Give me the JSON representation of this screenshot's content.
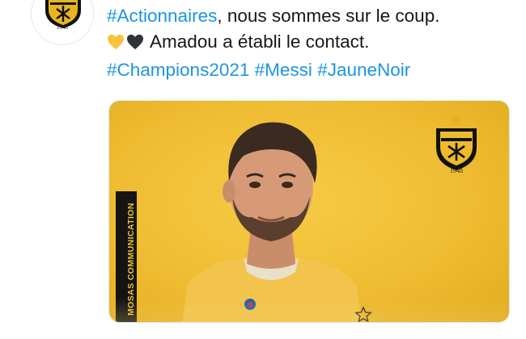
{
  "avatar": {
    "club_name": "ASEC MIMOSAS",
    "year": "1948"
  },
  "tweet": {
    "line1_hashtag": "#Actionnaires",
    "line1_text": ", nous sommes sur le coup.",
    "line2_emojis": [
      "yellow-heart",
      "black-heart"
    ],
    "line2_text": "Amadou a établi le contact.",
    "hashtags": [
      "#Champions2021",
      "#Messi",
      "#JauneNoir"
    ]
  },
  "media": {
    "side_label": "MOSAS COMMUNICATION",
    "badge_club": "ASEC MIMOSAS",
    "badge_year": "1948",
    "jersey_star": "☆"
  },
  "colors": {
    "hashtag": "#1b95e0",
    "text": "#14171a",
    "image_bg": "#efbd33",
    "side_band": "#141414",
    "side_text": "#f1c232"
  }
}
